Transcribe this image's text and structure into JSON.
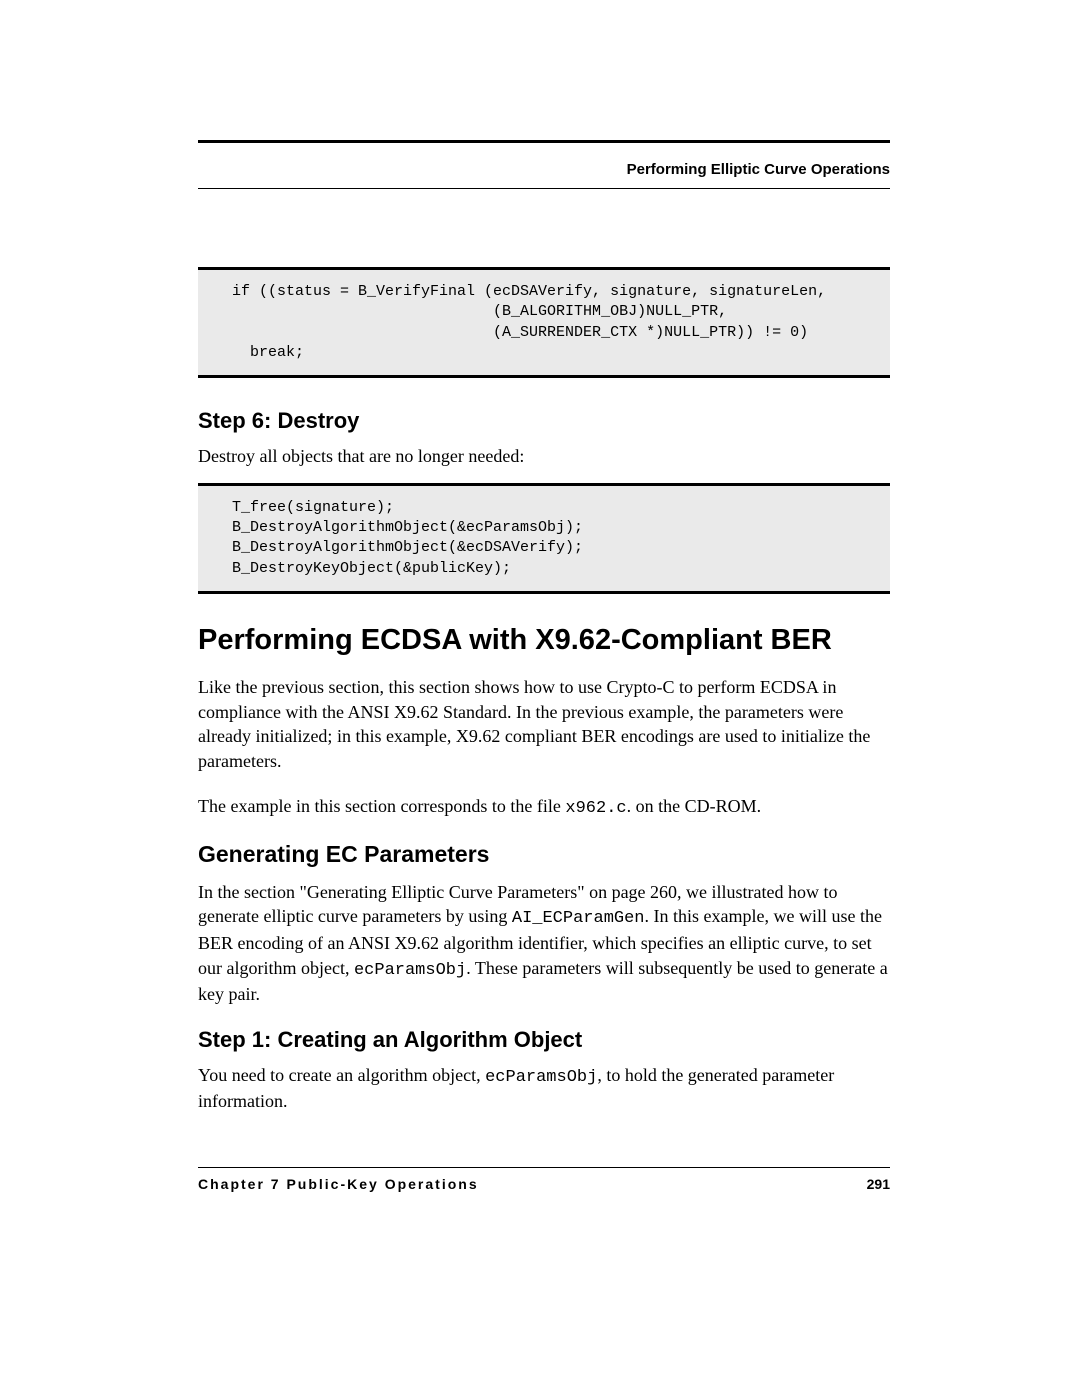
{
  "header": {
    "running_title": "Performing Elliptic Curve Operations"
  },
  "code1": "  if ((status = B_VerifyFinal (ecDSAVerify, signature, signatureLen,\n                               (B_ALGORITHM_OBJ)NULL_PTR,\n                               (A_SURRENDER_CTX *)NULL_PTR)) != 0)\n    break;",
  "step6": {
    "heading": "Step 6:  Destroy",
    "text": "Destroy all objects that are no longer needed:"
  },
  "code2": "  T_free(signature);\n  B_DestroyAlgorithmObject(&ecParamsObj);\n  B_DestroyAlgorithmObject(&ecDSAVerify);\n  B_DestroyKeyObject(&publicKey);",
  "section": {
    "title": "Performing ECDSA with X9.62-Compliant BER",
    "para1": "Like the previous section, this section shows how to use Crypto-C to perform ECDSA in compliance with the ANSI X9.62 Standard. In the previous example, the parameters were already initialized; in this example, X9.62 compliant BER encodings are used to initialize the parameters.",
    "para2_pre": "The example in this section corresponds to the file ",
    "para2_code": "x962.c",
    "para2_post": ". on the CD-ROM."
  },
  "gen_params": {
    "heading": "Generating EC Parameters",
    "para_pre": "In the section \"Generating Elliptic Curve Parameters\" on page 260, we illustrated how to generate elliptic curve parameters by using ",
    "para_code1": "AI_ECParamGen",
    "para_mid": ".  In this example, we will use the BER encoding of an ANSI X9.62 algorithm identifier, which specifies an elliptic curve, to set our algorithm object, ",
    "para_code2": "ecParamsObj",
    "para_post": ".  These parameters will subsequently be used to generate a key pair."
  },
  "step1": {
    "heading": "Step 1: Creating an Algorithm Object",
    "para_pre": "You need to create an algorithm object, ",
    "para_code": "ecParamsObj",
    "para_post": ", to hold the generated parameter information."
  },
  "footer": {
    "chapter": "Chapter 7  Public-Key Operations",
    "page": "291"
  }
}
